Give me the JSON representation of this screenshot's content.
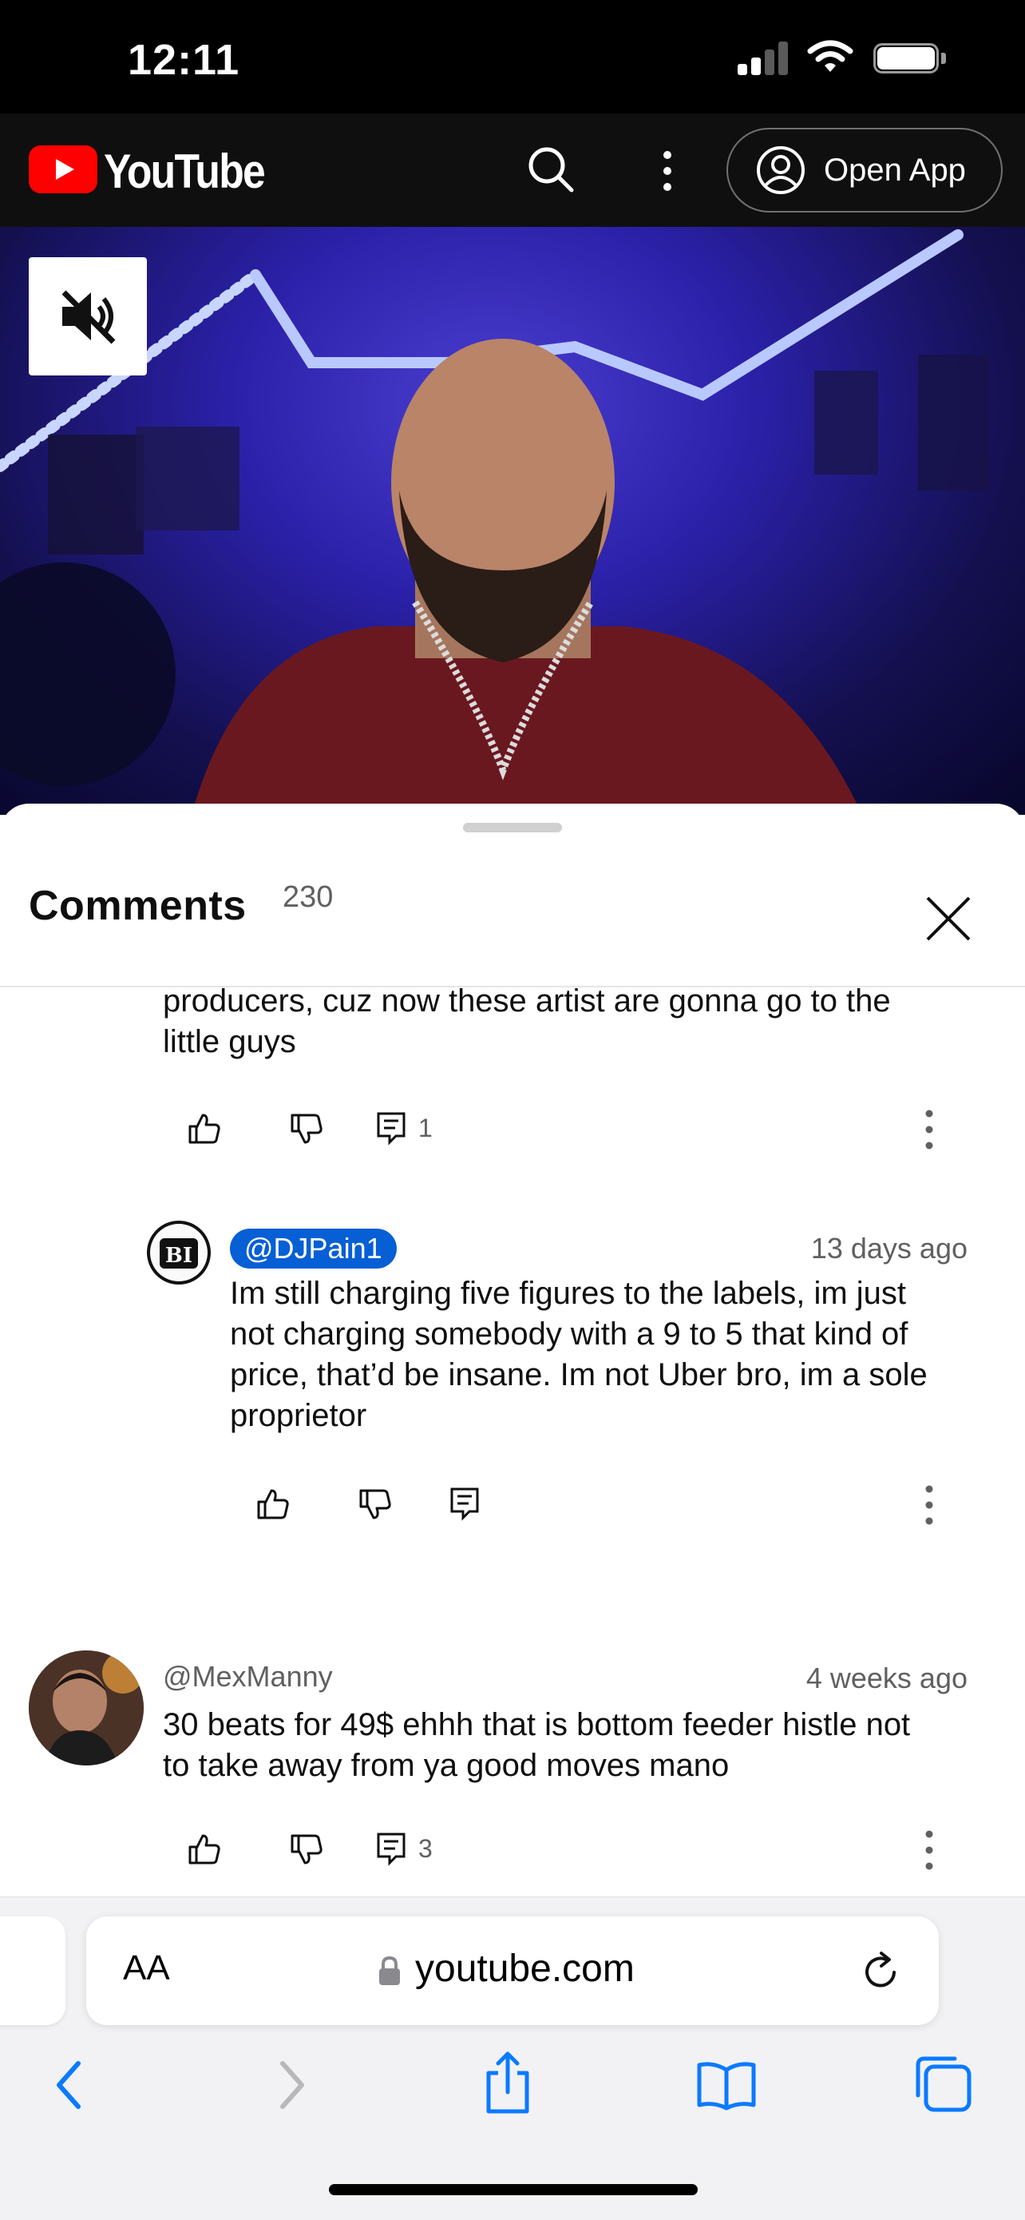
{
  "status_bar": {
    "time": "12:11"
  },
  "header": {
    "brand": "YouTube",
    "open_app_label": "Open App"
  },
  "comments_panel": {
    "title": "Comments",
    "count": "230",
    "comments": [
      {
        "text_lines": [
          "producers, cuz now these artist are gonna go to the",
          "little guys"
        ],
        "reply_count": "1"
      },
      {
        "author": "@DJPain1",
        "time": "13 days ago",
        "text_lines": [
          "Im still charging five figures to the labels, im just",
          "not charging somebody with a 9 to 5 that kind of",
          "price, that’d be insane. Im not Uber bro, im a sole",
          "proprietor"
        ],
        "avatar_initials": "BI"
      },
      {
        "author": "@MexManny",
        "time": "4 weeks ago",
        "text_lines": [
          "30 beats for 49$ ehhh that is bottom feeder histle not",
          "to take away from ya good moves mano"
        ],
        "reply_count": "3"
      }
    ]
  },
  "browser": {
    "text_size_label": "AA",
    "url": "youtube.com"
  },
  "colors": {
    "accent": "#065fd4",
    "yt_red": "#ff0000",
    "ios_blue": "#0a7aff"
  }
}
